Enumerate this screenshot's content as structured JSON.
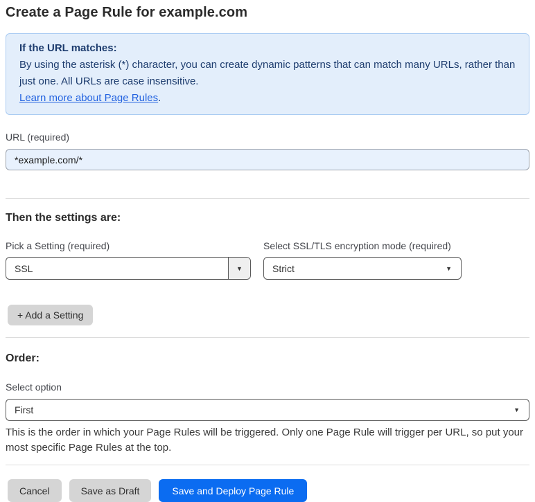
{
  "page": {
    "title": "Create a Page Rule for example.com"
  },
  "info_box": {
    "heading": "If the URL matches:",
    "body": "By using the asterisk (*) character, you can create dynamic patterns that can match many URLs, rather than just one. All URLs are case insensitive.",
    "link_label": "Learn more about Page Rules",
    "link_suffix": "."
  },
  "url_field": {
    "label": "URL (required)",
    "value": "*example.com/*"
  },
  "settings_section": {
    "heading": "Then the settings are:",
    "pick_setting": {
      "label": "Pick a Setting (required)",
      "selected": "SSL"
    },
    "ssl_mode": {
      "label": "Select SSL/TLS encryption mode (required)",
      "selected": "Strict"
    },
    "add_setting_label": "+ Add a Setting"
  },
  "order_section": {
    "heading": "Order:",
    "select_label": "Select option",
    "selected": "First",
    "help_text": "This is the order in which your Page Rules will be triggered. Only one Page Rule will trigger per URL, so put your most specific Page Rules at the top."
  },
  "footer": {
    "cancel_label": "Cancel",
    "save_draft_label": "Save as Draft",
    "save_deploy_label": "Save and Deploy Page Rule"
  },
  "icons": {
    "dropdown_arrow": "▼"
  },
  "colors": {
    "accent_blue": "#0b6cf1",
    "info_bg": "#e3eefb",
    "info_border": "#a9cbf2",
    "info_text": "#1d3c6e",
    "link_blue": "#2363e0",
    "input_bg": "#e8f1fd"
  }
}
